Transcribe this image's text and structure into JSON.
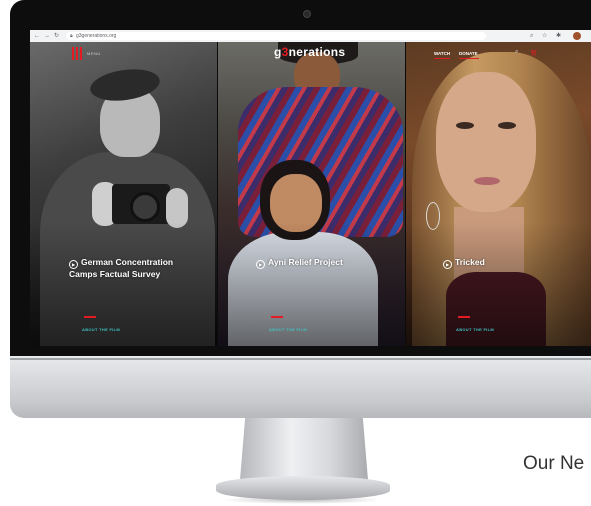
{
  "browser": {
    "url": "g3generations.org",
    "nav_icons": [
      "back-arrow-icon",
      "forward-arrow-icon",
      "reload-icon"
    ],
    "extension_icons": [
      "search-icon",
      "star-icon",
      "puzzle-icon",
      "profile-avatar"
    ]
  },
  "site": {
    "logo_prefix": "g",
    "logo_accent": "3",
    "logo_suffix": "nerations",
    "menu_label": "MENU",
    "nav": {
      "watch": "WATCH",
      "donate": "DONATE"
    },
    "accent_color": "#e31b23",
    "link_color": "#3fc3c3"
  },
  "films": [
    {
      "title_line1": "German Concentration",
      "title_line2": "Camps Factual Survey",
      "cta": "ABOUT THE FILM"
    },
    {
      "title_line1": "Ayni Relief Project",
      "title_line2": "",
      "cta": "ABOUT THE FILM"
    },
    {
      "title_line1": "Tricked",
      "title_line2": "",
      "cta": "ABOUT THE FILM"
    }
  ],
  "page": {
    "section_heading_visible": "Our Ne"
  }
}
